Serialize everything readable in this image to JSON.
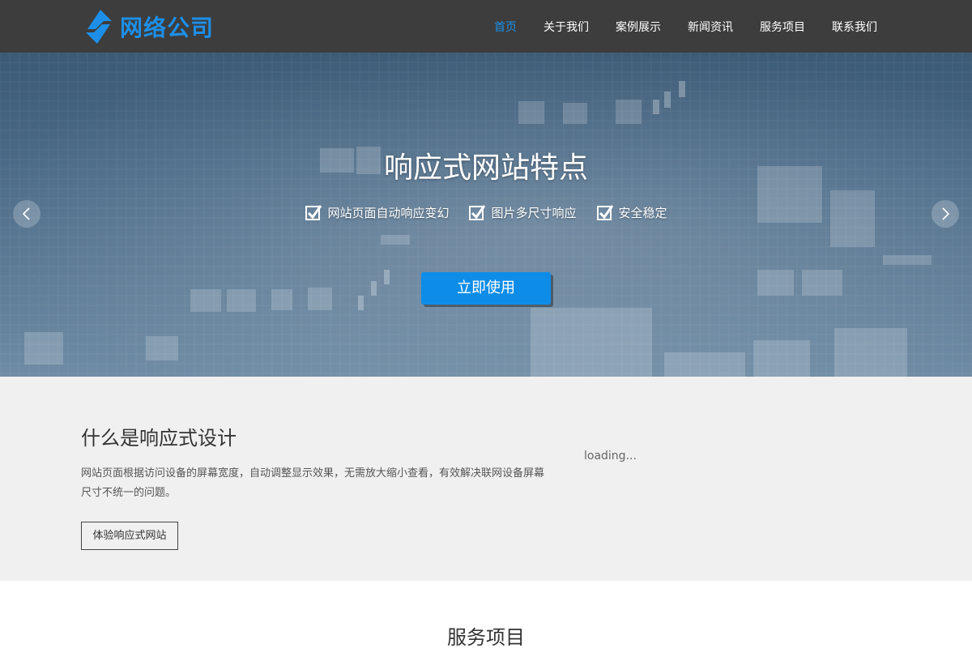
{
  "header": {
    "logo_text": "网络公司",
    "nav": [
      {
        "label": "首页",
        "active": true
      },
      {
        "label": "关于我们"
      },
      {
        "label": "案例展示"
      },
      {
        "label": "新闻资讯"
      },
      {
        "label": "服务项目"
      },
      {
        "label": "联系我们"
      }
    ]
  },
  "hero": {
    "title": "响应式网站特点",
    "features": [
      "网站页面自动响应变幻",
      "图片多尺寸响应",
      "安全稳定"
    ],
    "cta_label": "立即使用"
  },
  "intro": {
    "title": "什么是响应式设计",
    "text": "网站页面根据访问设备的屏幕宽度，自动调整显示效果，无需放大缩小查看，有效解决联网设备屏幕尺寸不统一的问题。",
    "button_label": "体验响应式网站",
    "loading_text": "loading..."
  },
  "services": {
    "title": "服务项目"
  },
  "icons": {
    "logo": "logo-icon",
    "check": "checkmark-icon",
    "prev": "chevron-left-icon",
    "next": "chevron-right-icon"
  },
  "colors": {
    "header_bg": "#3d3d3d",
    "accent": "#1d8fe8",
    "cta": "#0e8de8",
    "intro_bg": "#f0f0f0"
  }
}
